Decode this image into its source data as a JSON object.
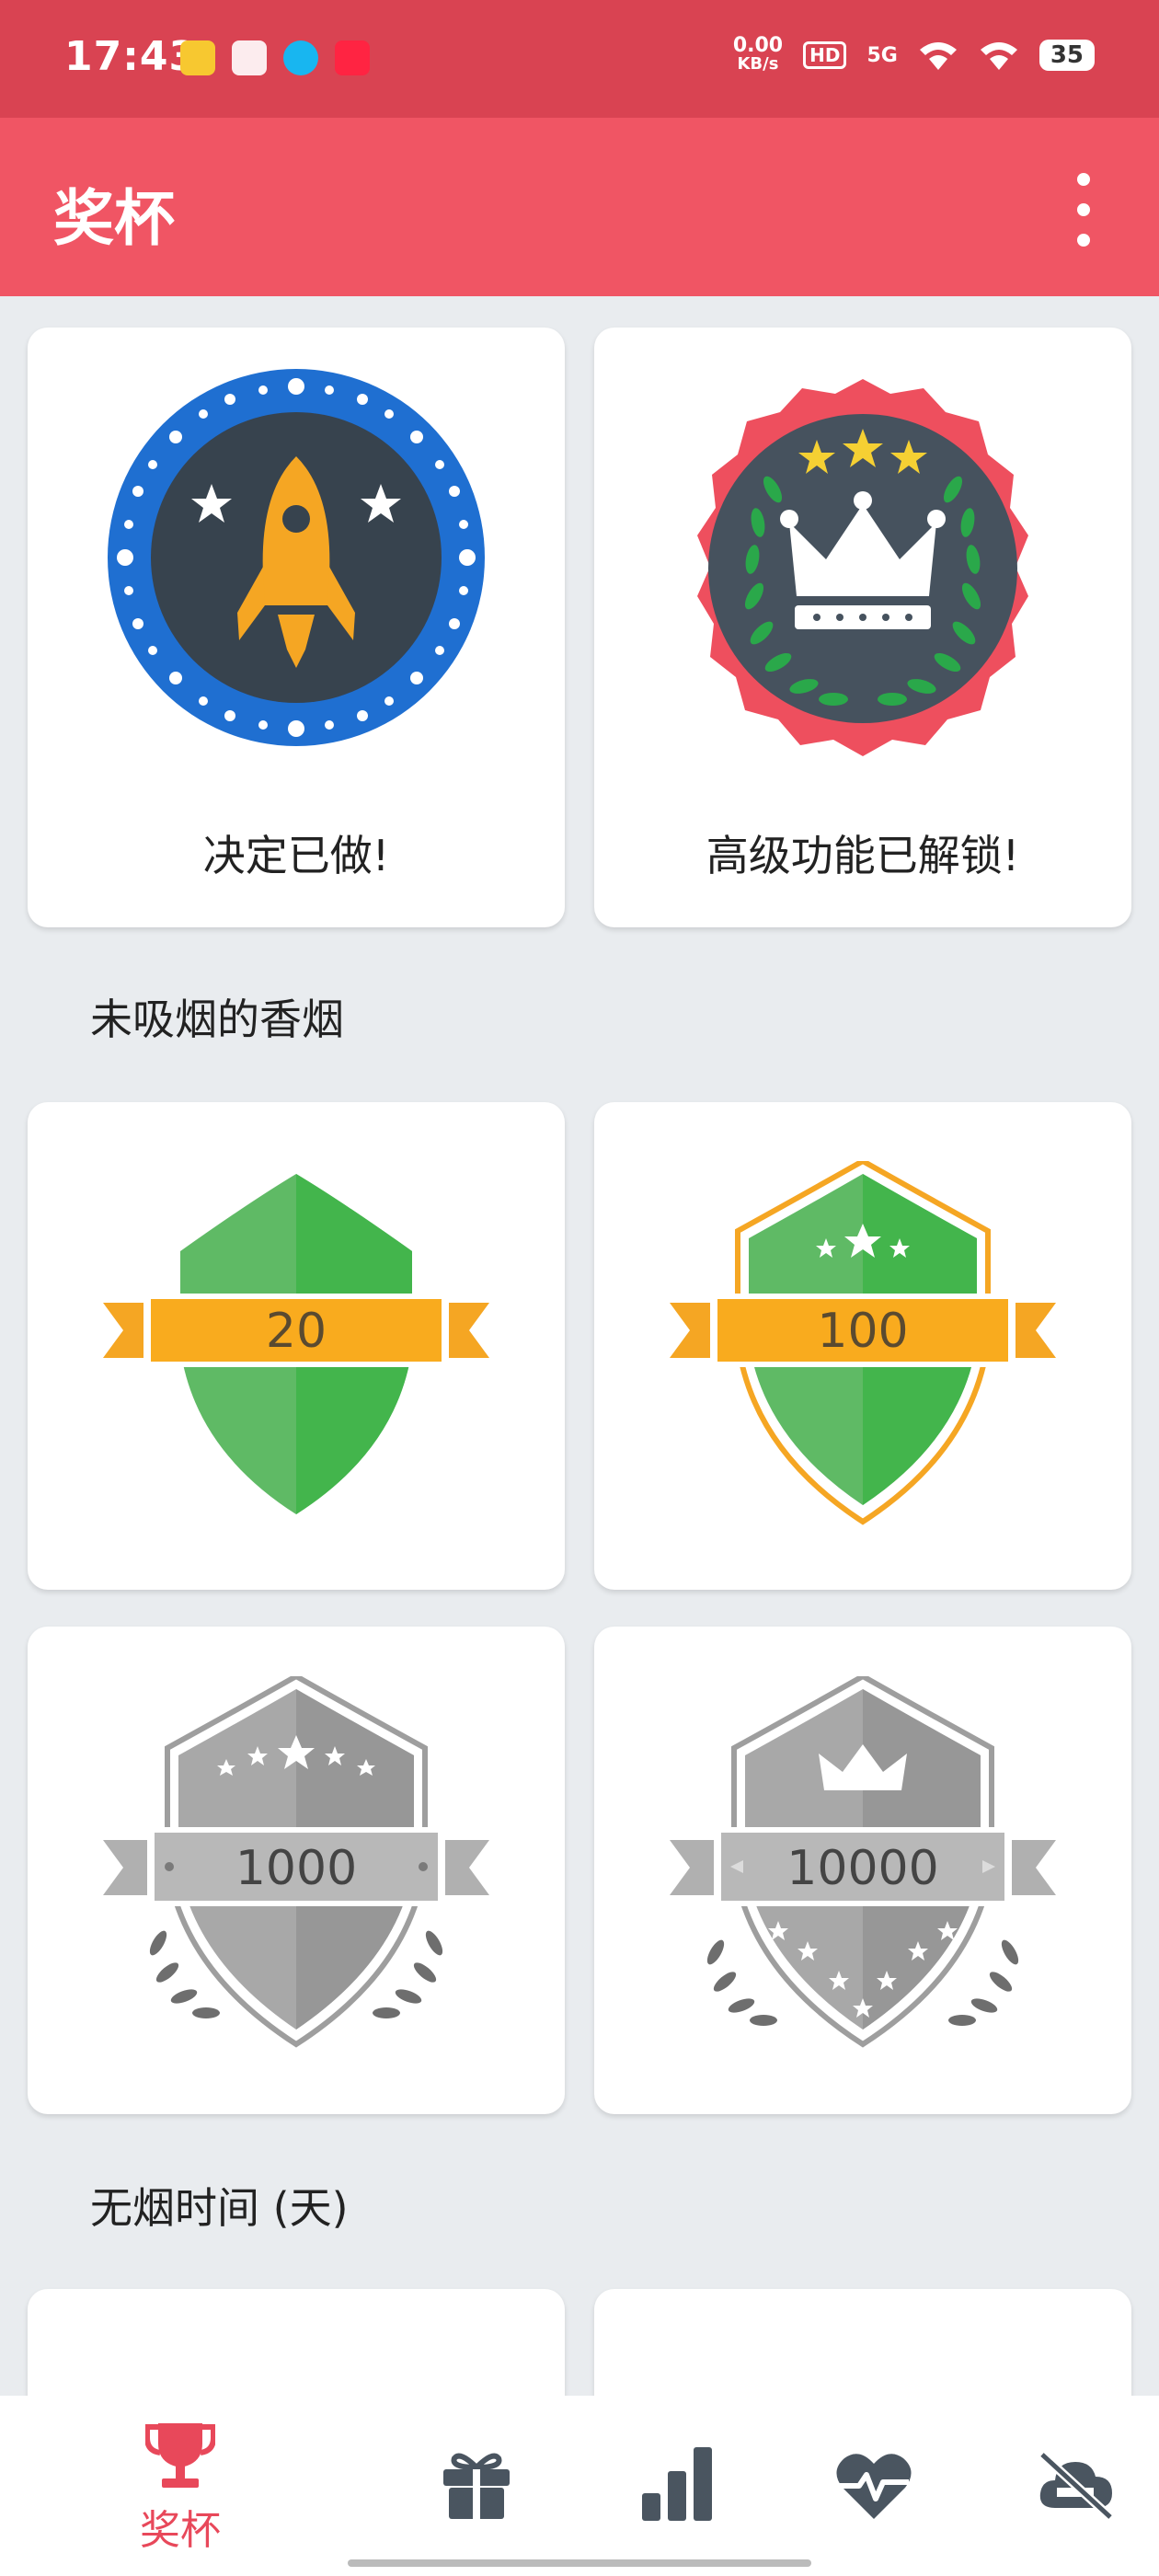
{
  "status_bar": {
    "time": "17:43",
    "net_speed_value": "0.00",
    "net_speed_unit": "KB/s",
    "hd": "HD",
    "signal": "5G",
    "battery": "35"
  },
  "app_bar": {
    "title": "奖杯"
  },
  "top_cards": [
    {
      "label": "决定已做!",
      "icon": "rocket-badge-icon"
    },
    {
      "label": "高级功能已解锁!",
      "icon": "crown-laurel-badge-icon"
    }
  ],
  "sections": {
    "unsmoked": {
      "title": "未吸烟的香烟",
      "badges": [
        {
          "value": "20",
          "state": "unlocked"
        },
        {
          "value": "100",
          "state": "unlocked"
        },
        {
          "value": "1000",
          "state": "locked"
        },
        {
          "value": "10000",
          "state": "locked"
        }
      ]
    },
    "smoke_free": {
      "title": "无烟时间 (天)"
    }
  },
  "bottom_nav": {
    "items": [
      {
        "name": "trophies",
        "label": "奖杯",
        "icon": "trophy-icon",
        "active": true
      },
      {
        "name": "gifts",
        "icon": "gift-icon",
        "active": false
      },
      {
        "name": "stats",
        "icon": "bar-chart-icon",
        "active": false
      },
      {
        "name": "health",
        "icon": "heartbeat-icon",
        "active": false
      },
      {
        "name": "no-smoking",
        "icon": "no-smoking-cloud-icon",
        "active": false
      }
    ]
  },
  "colors": {
    "accent": "#f05564",
    "status_bar": "#d94352",
    "active_nav": "#e8485a",
    "inactive_nav": "#4a5560",
    "background": "#e9ecef"
  }
}
